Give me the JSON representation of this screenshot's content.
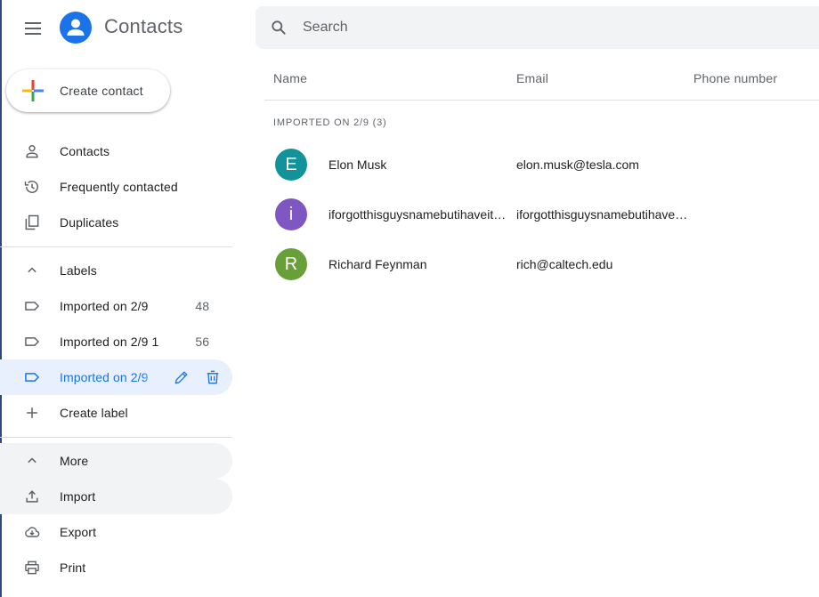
{
  "header": {
    "app_title": "Contacts",
    "search_placeholder": "Search"
  },
  "sidebar": {
    "create_label": "Create contact",
    "main_items": [
      {
        "label": "Contacts",
        "icon": "person-icon"
      },
      {
        "label": "Frequently contacted",
        "icon": "history-icon"
      },
      {
        "label": "Duplicates",
        "icon": "duplicates-icon"
      }
    ],
    "labels_header": "Labels",
    "labels": [
      {
        "label": "Imported on 2/9",
        "count": "48"
      },
      {
        "label": "Imported on 2/9 1",
        "count": "56"
      },
      {
        "label": "Imported on 2/9",
        "count": ""
      }
    ],
    "create_label_text": "Create label",
    "more_header": "More",
    "more_items": [
      {
        "label": "Import",
        "icon": "upload-icon"
      },
      {
        "label": "Export",
        "icon": "cloud-download-icon"
      },
      {
        "label": "Print",
        "icon": "print-icon"
      }
    ]
  },
  "table": {
    "columns": [
      "Name",
      "Email",
      "Phone number"
    ],
    "group_title": "IMPORTED ON 2/9 (3)",
    "rows": [
      {
        "initial": "E",
        "name": "Elon Musk",
        "email": "elon.musk@tesla.com",
        "color": "#12939a"
      },
      {
        "initial": "i",
        "name": "iforgotthisguysnamebutihaveitsaved",
        "email": "iforgotthisguysnamebutihaveitsaved@gmail.com",
        "color": "#7e57c2"
      },
      {
        "initial": "R",
        "name": "Richard Feynman",
        "email": "rich@caltech.edu",
        "color": "#689f38"
      }
    ]
  },
  "colors": {
    "accent": "#1a73e8",
    "active_bg": "#e8f0fe",
    "hover_bg": "#f1f3f4"
  }
}
